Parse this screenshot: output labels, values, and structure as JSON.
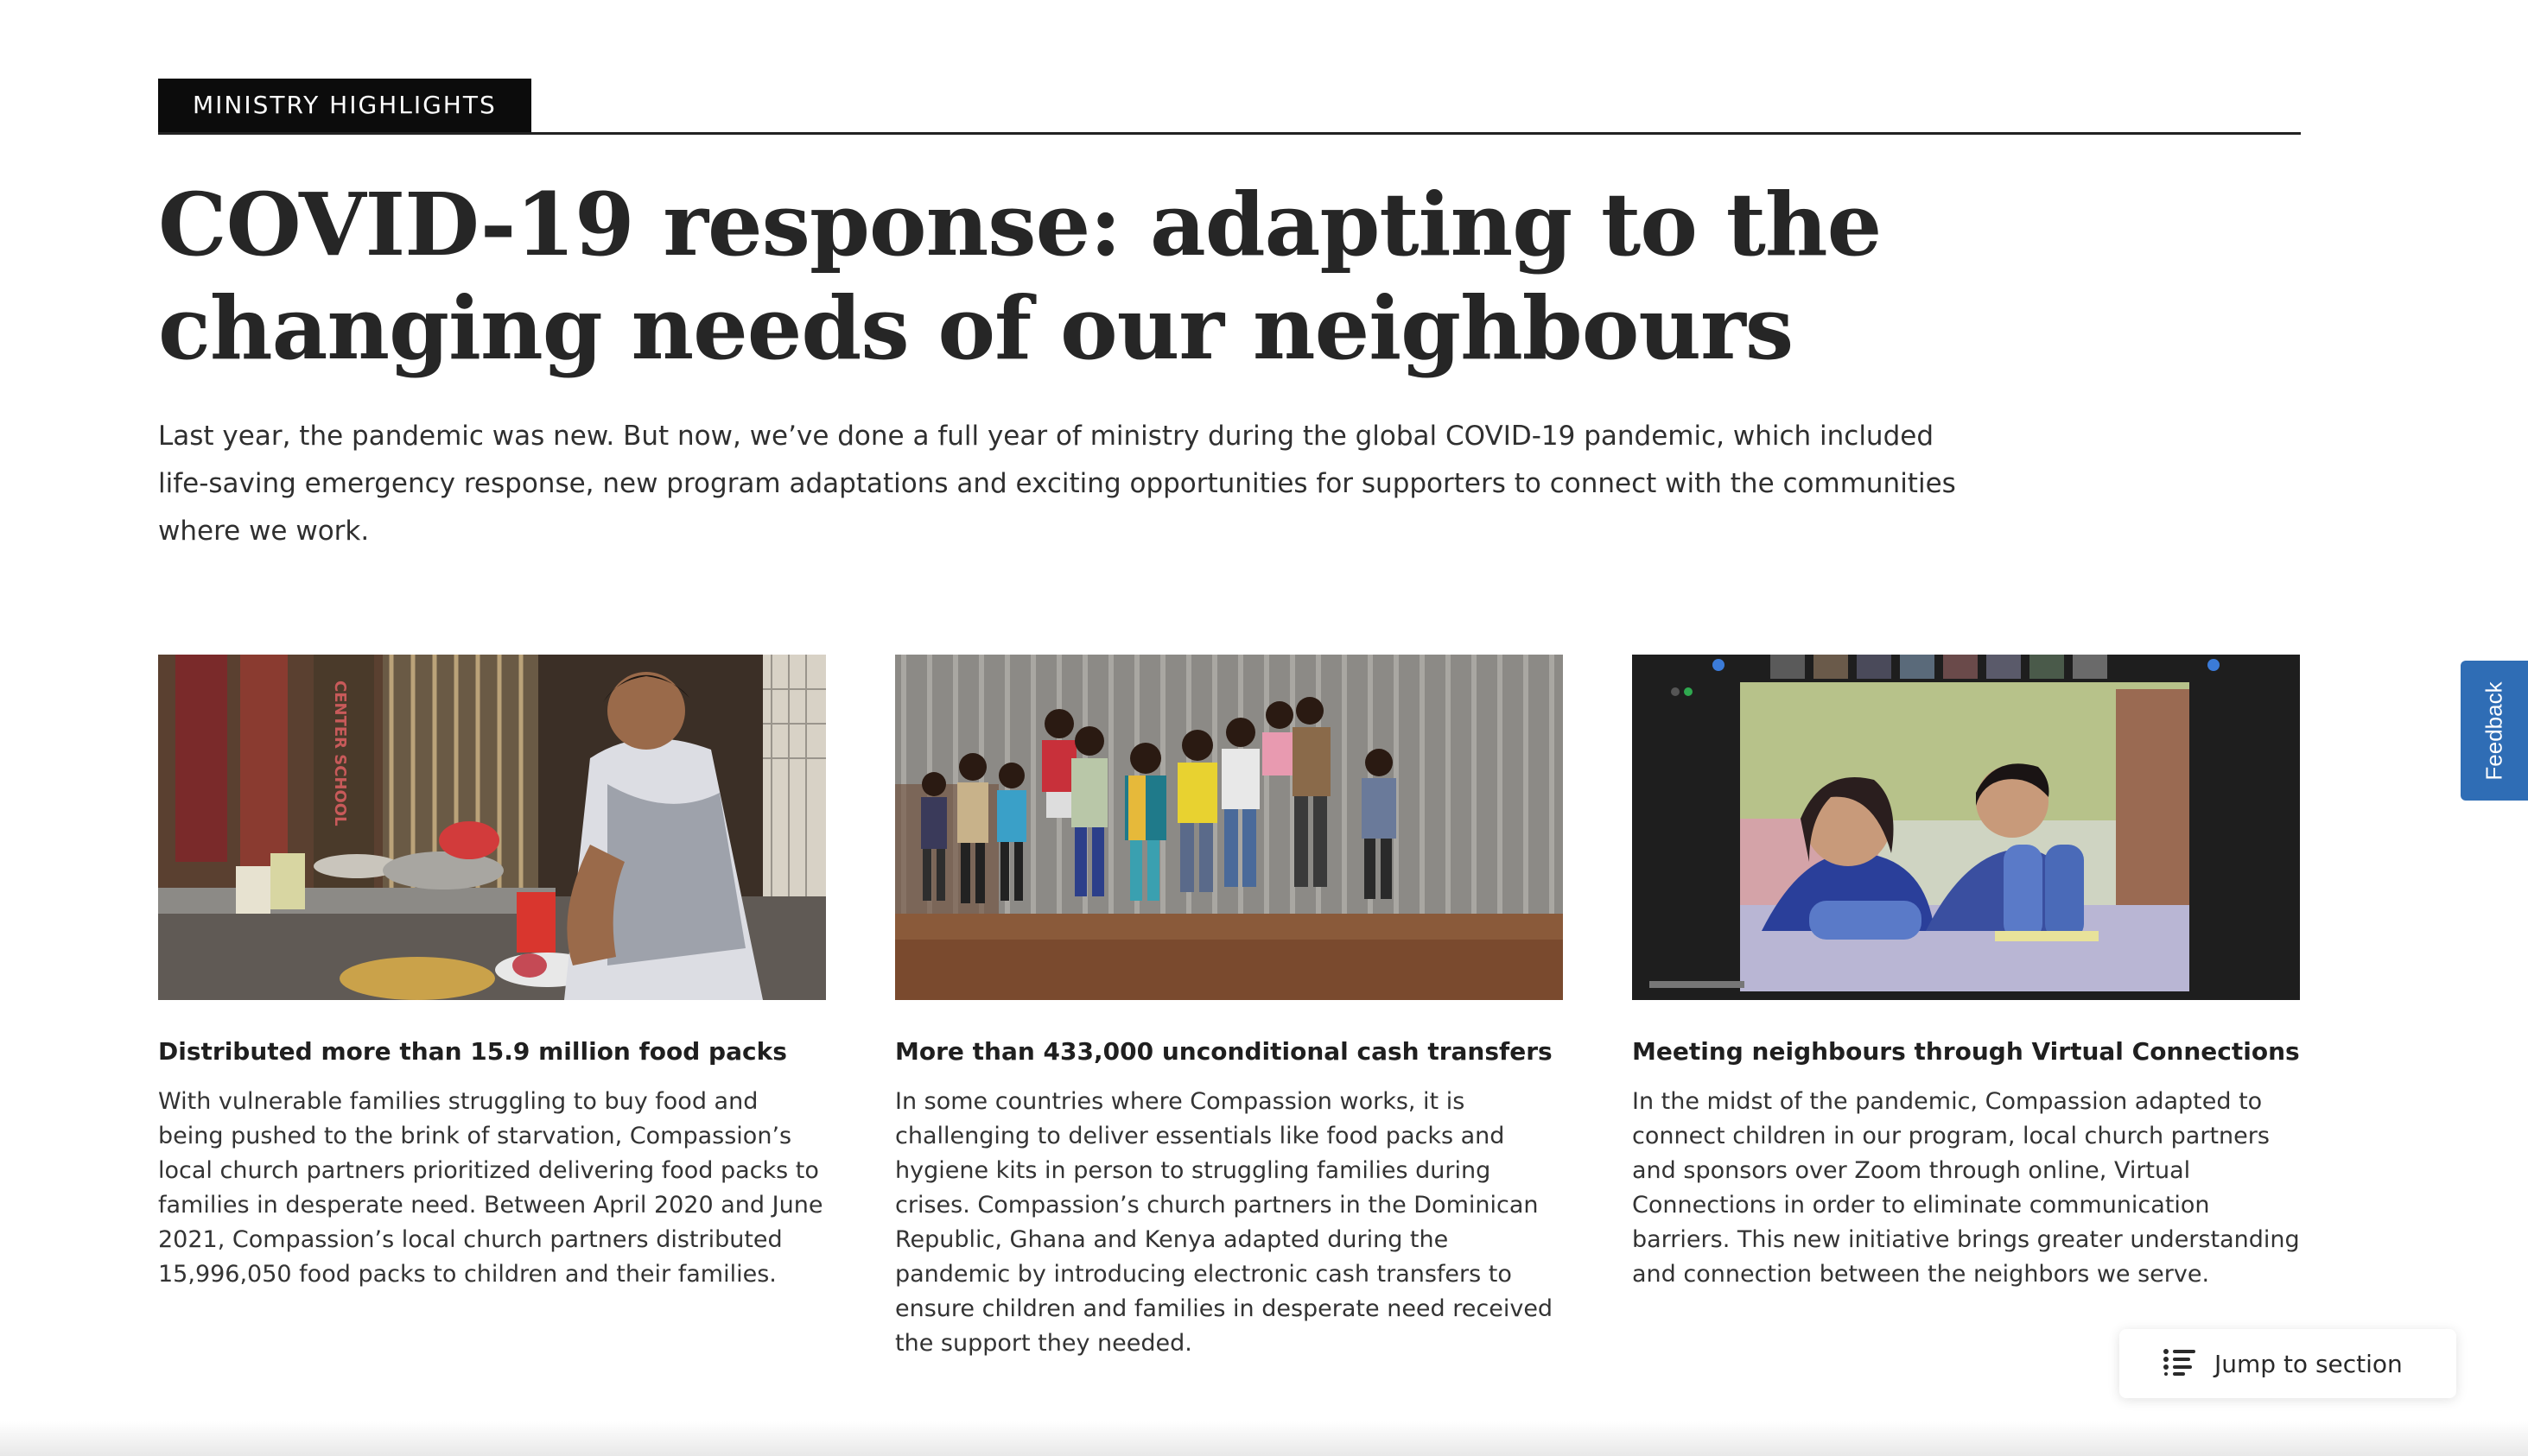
{
  "section": {
    "eyebrow": "MINISTRY HIGHLIGHTS",
    "headline": "COVID-19 response: adapting to the changing needs of our neighbours",
    "intro": "Last year, the pandemic was new. But now, we’ve done a full year of ministry during the global COVID-19 pandemic, which included life-saving emergency response, new program adaptations and exciting opportunities for supporters to connect with the communities where we work."
  },
  "cards": [
    {
      "title": "Distributed more than 15.9 million food packs",
      "body": "With vulnerable families struggling to buy food and being pushed to the brink of starvation, Compassion’s local church partners prioritized delivering food packs to families in desperate need. Between April 2020 and June 2021, Compassion’s local church partners distributed 15,996,050 food packs to children and their families.",
      "image_sign_text": "CENTER SCHOOL"
    },
    {
      "title": "More than 433,000 unconditional cash transfers",
      "body": "In some countries where Compassion works, it is challenging to deliver essentials like food packs and hygiene kits in person to struggling families during crises. Compassion’s church partners in the Dominican Republic, Ghana and Kenya adapted during the pandemic by introducing electronic cash transfers to ensure children and families in desperate need received the support they needed."
    },
    {
      "title": "Meeting neighbours through Virtual Connections",
      "body": "In the midst of the pandemic, Compassion adapted to connect children in our program, local church partners and sponsors over Zoom through online, Virtual Connections in order to eliminate communication barriers. This new initiative brings greater understanding and connection between the neighbors we serve."
    }
  ],
  "feedback": {
    "label": "Feedback",
    "color": "#2f6db5"
  },
  "jump": {
    "label": "Jump to section",
    "icon": "list-icon"
  }
}
